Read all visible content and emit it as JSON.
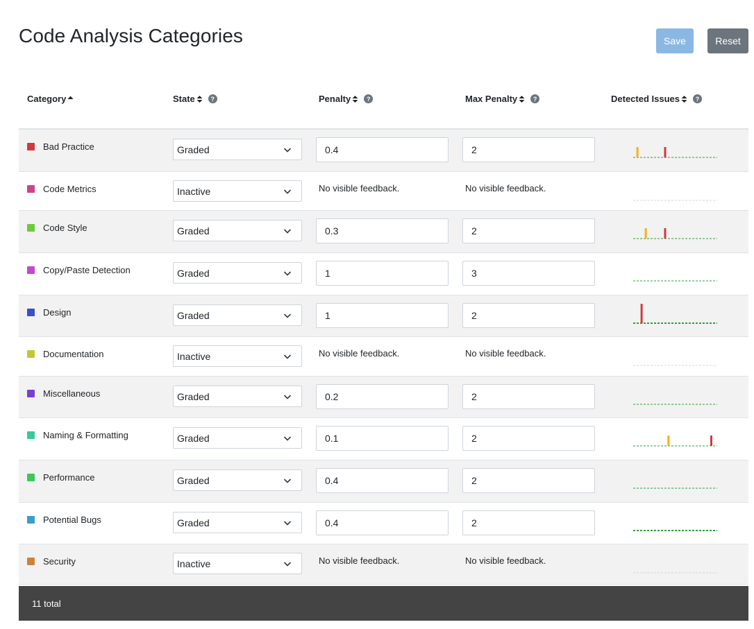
{
  "page": {
    "title": "Code Analysis Categories"
  },
  "toolbar": {
    "save_label": "Save",
    "reset_label": "Reset"
  },
  "columns": {
    "category": "Category",
    "state": "State",
    "penalty": "Penalty",
    "max_penalty": "Max Penalty",
    "detected_issues": "Detected Issues",
    "help_glyph": "?"
  },
  "sort": {
    "column": "category",
    "direction": "ascending"
  },
  "no_feedback_text": "No visible feedback.",
  "rows": [
    {
      "label": "Bad Practice",
      "color": "#d0393e",
      "state": "Graded",
      "penalty": "0.4",
      "max_penalty": "2",
      "issues": [
        {
          "pos": 0.05,
          "color": "#f2b418",
          "level": 0.55
        },
        {
          "pos": 0.38,
          "color": "#d0393e",
          "level": 0.55
        }
      ]
    },
    {
      "label": "Code Metrics",
      "color": "#d0428a",
      "state": "Inactive",
      "penalty": "",
      "max_penalty": "",
      "issues": []
    },
    {
      "label": "Code Style",
      "color": "#6fc93c",
      "state": "Graded",
      "penalty": "0.3",
      "max_penalty": "2",
      "issues": [
        {
          "pos": 0.15,
          "color": "#f2b418",
          "level": 0.55
        },
        {
          "pos": 0.38,
          "color": "#d0393e",
          "level": 0.55
        }
      ]
    },
    {
      "label": "Copy/Paste Detection",
      "color": "#c348cc",
      "state": "Graded",
      "penalty": "1",
      "max_penalty": "3",
      "issues": []
    },
    {
      "label": "Design",
      "color": "#3a4fc8",
      "state": "Graded",
      "penalty": "1",
      "max_penalty": "2",
      "issues": [
        {
          "pos": 0.1,
          "color": "#d0393e",
          "level": 1.0
        }
      ]
    },
    {
      "label": "Documentation",
      "color": "#c0c934",
      "state": "Inactive",
      "penalty": "",
      "max_penalty": "",
      "issues": []
    },
    {
      "label": "Miscellaneous",
      "color": "#7a3fcf",
      "state": "Graded",
      "penalty": "0.2",
      "max_penalty": "2",
      "issues": []
    },
    {
      "label": "Naming & Formatting",
      "color": "#38c99a",
      "state": "Graded",
      "penalty": "0.1",
      "max_penalty": "2",
      "issues": [
        {
          "pos": 0.42,
          "color": "#f2b418",
          "level": 0.55
        },
        {
          "pos": 0.93,
          "color": "#d0393e",
          "level": 0.55
        }
      ]
    },
    {
      "label": "Performance",
      "color": "#3ac956",
      "state": "Graded",
      "penalty": "0.4",
      "max_penalty": "2",
      "issues": []
    },
    {
      "label": "Potential Bugs",
      "color": "#3a9fcc",
      "state": "Graded",
      "penalty": "0.4",
      "max_penalty": "2",
      "issues": []
    },
    {
      "label": "Security",
      "color": "#cc8338",
      "state": "Inactive",
      "penalty": "",
      "max_penalty": "",
      "issues": []
    }
  ],
  "footer": {
    "total_label": "11 total"
  }
}
